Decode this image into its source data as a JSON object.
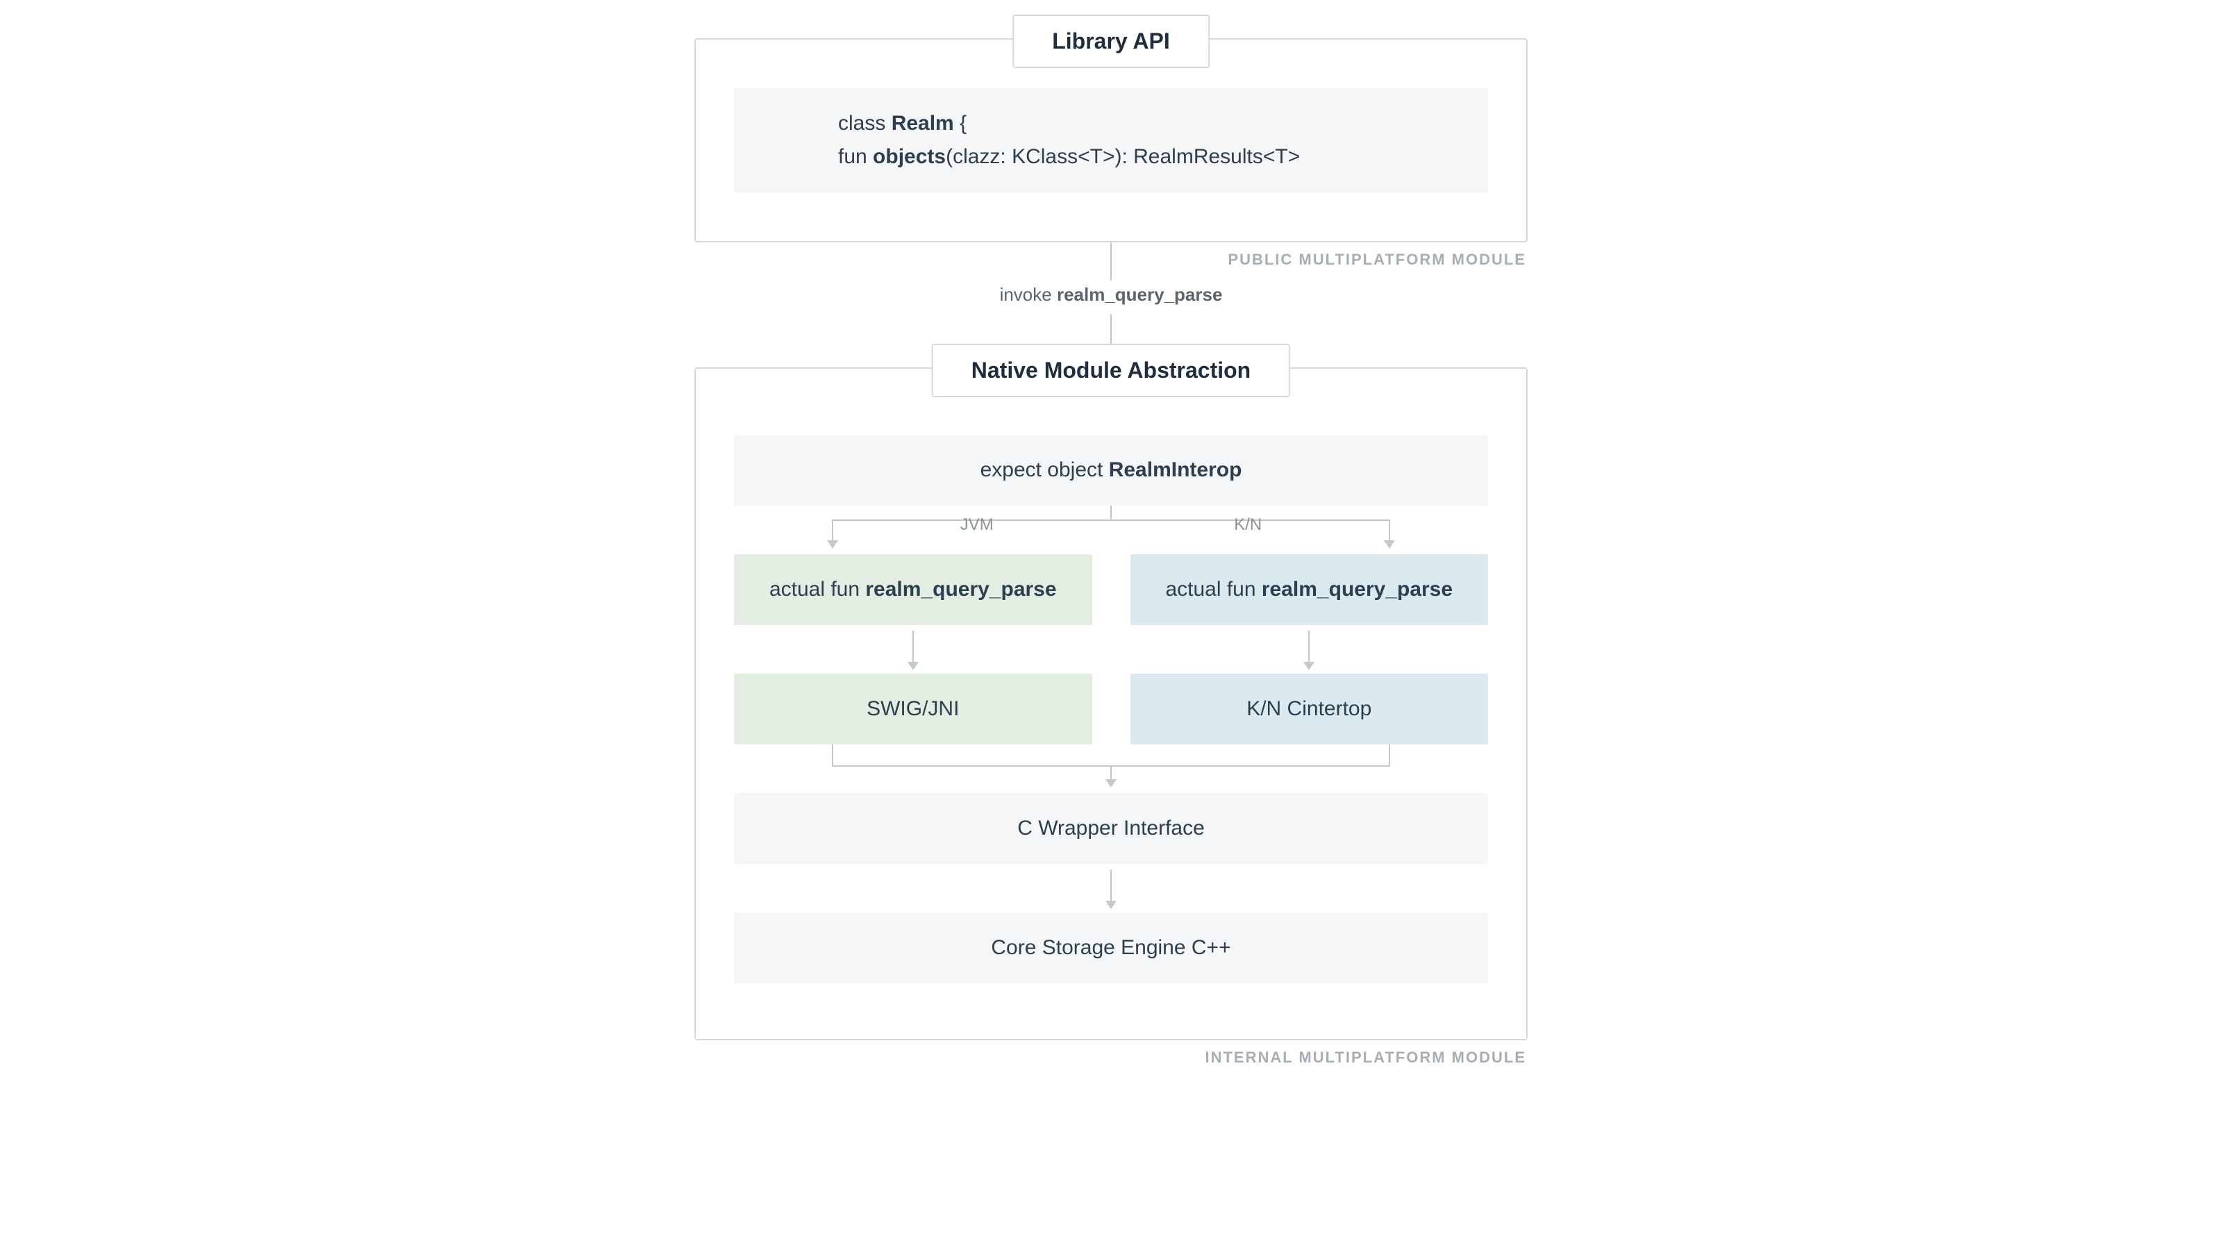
{
  "module1": {
    "title": "Library API",
    "caption": "PUBLIC MULTIPLATFORM MODULE",
    "code": {
      "line1_pre": "class ",
      "line1_bold": "Realm",
      "line1_post": " {",
      "line2_pre": "fun ",
      "line2_bold": "objects",
      "line2_post": "(clazz: KClass<T>): RealmResults<T>"
    }
  },
  "connector1": {
    "label_pre": "invoke ",
    "label_bold": "realm_query_parse"
  },
  "module2": {
    "title": "Native Module Abstraction",
    "caption": "INTERNAL MULTIPLATFORM MODULE",
    "expect": {
      "pre": "expect object ",
      "bold": "RealmInterop"
    },
    "split": {
      "left": "JVM",
      "right": "K/N"
    },
    "actual_jvm": {
      "pre": "actual fun ",
      "bold": "realm_query_parse"
    },
    "actual_kn": {
      "pre": "actual fun ",
      "bold": "realm_query_parse"
    },
    "interop_jvm": "SWIG/JNI",
    "interop_kn": "K/N Cintertop",
    "cwrapper": "C Wrapper Interface",
    "core": "Core Storage Engine C++"
  }
}
